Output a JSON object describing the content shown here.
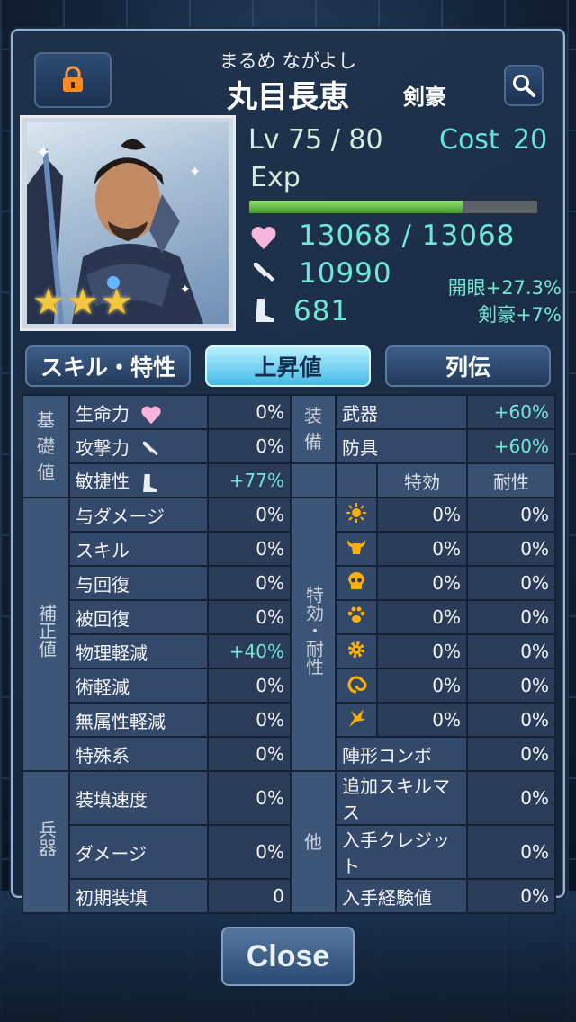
{
  "header": {
    "kana": "まるめ ながよし",
    "name": "丸目長恵",
    "class": "剣豪"
  },
  "status": {
    "lv_text": "Lv 75 / 80",
    "cost_label": "Cost",
    "cost_value": "20",
    "exp_label": "Exp",
    "exp_fraction": 0.74,
    "rarity_stars": 3,
    "hp_text": "13068 / 13068",
    "attack_text": "10990",
    "agility_text": "681",
    "bonus_1": "開眼+27.3%",
    "bonus_2": "剣豪+7%"
  },
  "tabs": [
    "スキル・特性",
    "上昇値",
    "列伝"
  ],
  "left": {
    "base_cat": "基礎値",
    "mod_cat": "補正値",
    "weap_cat": "兵器",
    "rows": [
      {
        "label": "生命力",
        "value": "0%"
      },
      {
        "label": "攻撃力",
        "value": "0%"
      },
      {
        "label": "敏捷性",
        "value": "+77%"
      },
      {
        "label": "与ダメージ",
        "value": "0%"
      },
      {
        "label": "スキル",
        "value": "0%"
      },
      {
        "label": "与回復",
        "value": "0%"
      },
      {
        "label": "被回復",
        "value": "0%"
      },
      {
        "label": "物理軽減",
        "value": "+40%"
      },
      {
        "label": "術軽減",
        "value": "0%"
      },
      {
        "label": "無属性軽減",
        "value": "0%"
      },
      {
        "label": "特殊系",
        "value": "0%"
      },
      {
        "label": "装填速度",
        "value": "0%"
      },
      {
        "label": "ダメージ",
        "value": "0%"
      },
      {
        "label": "初期装填",
        "value": "0"
      }
    ]
  },
  "right": {
    "equip_cat": "装備",
    "eff_cat": "特効・耐性",
    "other_cat": "他",
    "weapon": {
      "label": "武器",
      "value": "+60%"
    },
    "armor": {
      "label": "防具",
      "value": "+60%"
    },
    "hdr_effective": "特効",
    "hdr_resist": "耐性",
    "effects": [
      {
        "icon": "sun-icon",
        "eff": "0%",
        "res": "0%"
      },
      {
        "icon": "bull-icon",
        "eff": "0%",
        "res": "0%"
      },
      {
        "icon": "skull-icon",
        "eff": "0%",
        "res": "0%"
      },
      {
        "icon": "paw-icon",
        "eff": "0%",
        "res": "0%"
      },
      {
        "icon": "gear-icon",
        "eff": "0%",
        "res": "0%"
      },
      {
        "icon": "swirl-icon",
        "eff": "0%",
        "res": "0%"
      },
      {
        "icon": "wing-icon",
        "eff": "0%",
        "res": "0%"
      }
    ],
    "others": [
      {
        "label": "陣形コンボ",
        "value": "0%"
      },
      {
        "label": "追加スキルマス",
        "value": "0%"
      },
      {
        "label": "入手クレジット",
        "value": "0%"
      },
      {
        "label": "入手経験値",
        "value": "0%"
      }
    ]
  },
  "close_label": "Close",
  "colors": {
    "accent": "#6fe8d8",
    "star": "#f3c63e",
    "exp": "#8fe26b"
  }
}
